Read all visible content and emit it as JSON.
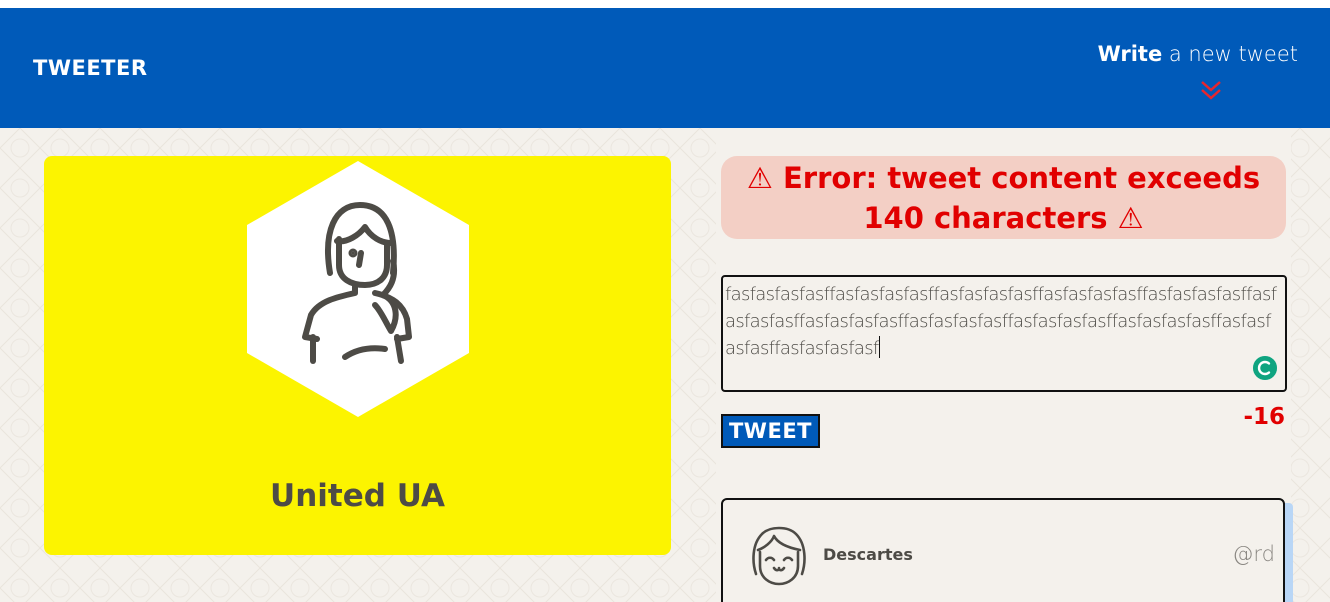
{
  "header": {
    "brand": "TWEETER",
    "write_bold": "Write",
    "write_rest": "a new tweet",
    "chevron_icon": "double-chevron-down-icon"
  },
  "profile": {
    "name": "United UA",
    "avatar_icon": "woman-long-hair-avatar-icon",
    "card_color": "#fcf400"
  },
  "composer": {
    "error_message": "⚠ Error: tweet content exceeds 140 characters ⚠",
    "input_value": "fasfasfasfasffasfasfasfasffasfasfasfasffasfasfasfasffasfasfasfasffasfasfasfasffasfasfasfasffasfasfasfasffasfasfasfasffasfasfasfasffasfasfasfasffasfasfasfasf",
    "grammar_icon": "grammarly-icon",
    "tweet_button": "TWEET",
    "char_counter": "-16"
  },
  "feed": [
    {
      "author": "Descartes",
      "handle": "@rd",
      "avatar_icon": "smiling-girl-avatar-icon"
    }
  ],
  "colors": {
    "header_bg": "#005ab9",
    "error_text": "#e10000",
    "error_bg": "#f3cfc5",
    "page_bg": "#f4f1ec"
  }
}
